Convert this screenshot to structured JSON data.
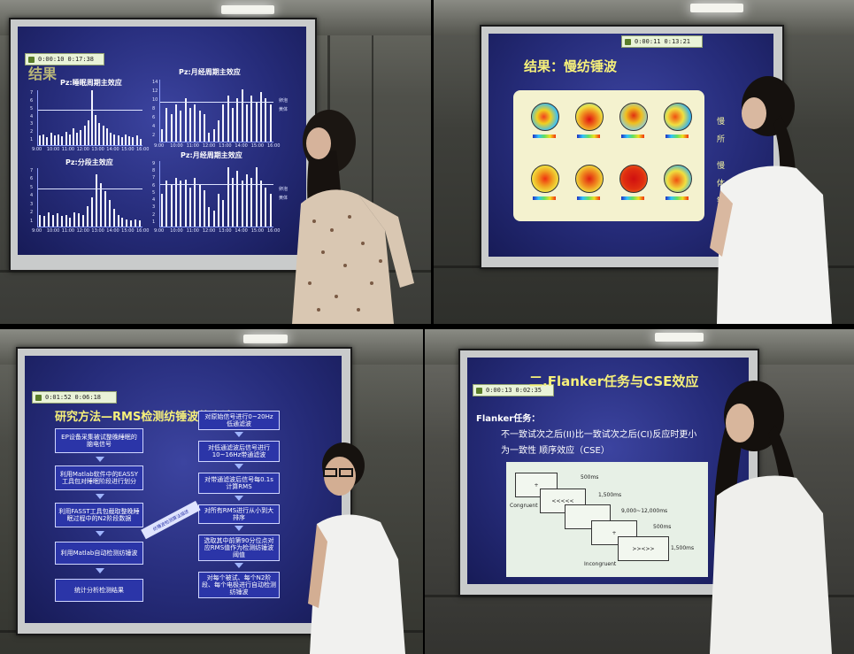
{
  "panels": [
    {
      "id": "top-left",
      "player": {
        "elapsed": "0:00:10",
        "total": "0:17:38"
      },
      "slide_title_fragment": "结果",
      "charts": [
        {
          "title": "Pz:睡眠周期主效应",
          "yticks": [
            "7",
            "6",
            "5",
            "4",
            "3",
            "2",
            "1"
          ],
          "xticks": [
            "9:00",
            "10:00",
            "11:00",
            "12:00",
            "13:00",
            "14:00",
            "15:00",
            "16:00"
          ]
        },
        {
          "title": "Pz:月经周期主效应",
          "yticks": [
            "14",
            "12",
            "10",
            "8",
            "6",
            "4",
            "2"
          ],
          "xticks": [
            "9:00",
            "10:00",
            "11:00",
            "12:00",
            "13:00",
            "14:00",
            "15:00",
            "16:00"
          ],
          "legend": [
            "卵泡",
            "黄体"
          ]
        },
        {
          "title": "Pz:分段主效应",
          "yticks": [
            "7",
            "6",
            "5",
            "4",
            "3",
            "2",
            "1"
          ],
          "xticks": [
            "9:00",
            "10:00",
            "11:00",
            "12:00",
            "13:00",
            "14:00",
            "15:00",
            "16:00"
          ]
        },
        {
          "title": "Pz:月经周期主效应",
          "yticks": [
            "9",
            "8",
            "7",
            "6",
            "5",
            "4",
            "3",
            "2",
            "1"
          ],
          "xticks": [
            "9:00",
            "10:00",
            "11:00",
            "12:00",
            "13:00",
            "14:00",
            "15:00",
            "16:00"
          ],
          "legend": [
            "卵泡",
            "黄体"
          ]
        }
      ]
    },
    {
      "id": "top-right",
      "player": {
        "elapsed": "0:00:11",
        "total": "0:13:21"
      },
      "slide_title": "结果：慢纺锤波",
      "side_texts": [
        "慢",
        "所",
        "慢",
        "体",
        "锤"
      ]
    },
    {
      "id": "bottom-left",
      "player": {
        "elapsed": "0:01:52",
        "total": "0:06:18"
      },
      "slide_title": "研究方法—RMS检测纺锤波的方法(1/2)",
      "left_flow": [
        "EP设备采集被试整晚睡眠的脑电信号",
        "利用Matlab软件中的EASSY工具包对睡眠阶段进行划分",
        "利用FASST工具包截取整晚睡眠过程中的N2阶段数据",
        "利用Matlab自动检测纺锤波",
        "统计分析检测结果"
      ],
      "right_flow": [
        "对原始信号进行0~20Hz低通滤波",
        "对低通滤波后信号进行10~16Hz带通滤波",
        "对带通滤波后信号每0.1s计算RMS",
        "对所有RMS进行从小到大排序",
        "选取其中前第90分位点对应RMS值作为检测纺锤波阈值",
        "对每个被试、每个N2阶段、每个电极进行自动检测纺锤波"
      ],
      "arrow_label": "纺锤波检测算法描述"
    },
    {
      "id": "bottom-right",
      "player": {
        "elapsed": "0:00:13",
        "total": "0:02:35"
      },
      "slide_title": "二.Flanker任务与CSE效应",
      "heading": "Flanker任务：",
      "line1": "不一致试次之后(II)比一致试次之后(CI)反应时更小",
      "line2": "为一致性 顺序效应（CSE）",
      "diagram": {
        "labels": [
          "Congruent",
          "Incongruent"
        ],
        "timings": [
          "500ms",
          "1,500ms",
          "9,000~12,000ms",
          "500ms",
          "1,500ms"
        ],
        "stimuli": [
          "+",
          "<<<<<",
          "+",
          ">><>>"
        ]
      }
    }
  ]
}
